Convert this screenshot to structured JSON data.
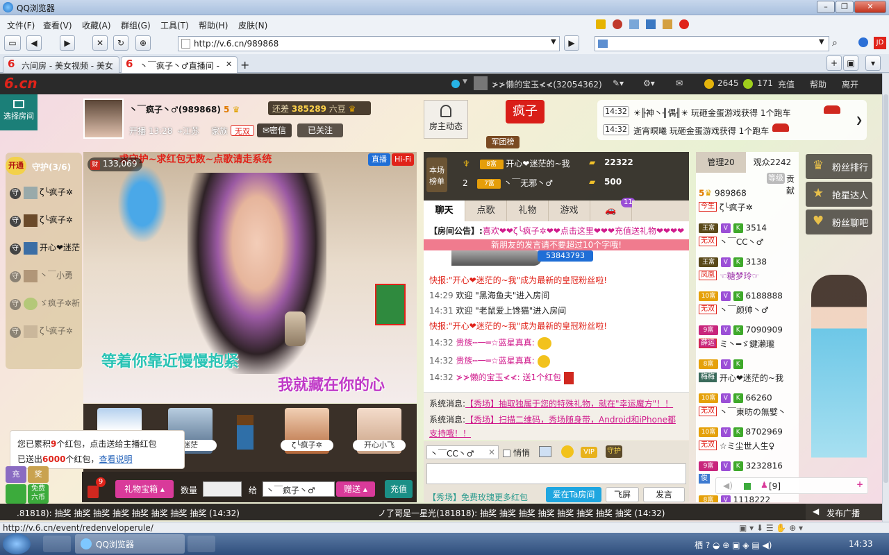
{
  "browser": {
    "title": "QQ浏览器",
    "menu": [
      "文件(F)",
      "查看(V)",
      "收藏(A)",
      "群组(G)",
      "工具(T)",
      "帮助(H)",
      "皮肤(N)"
    ],
    "address": "http://v.6.cn/989868",
    "tabs": [
      "六间房 - 美女视频 - 美女",
      "丶￣疯子丶♂直播间 -"
    ],
    "status_url": "http://v.6.cn/event/redenveloperule/",
    "clock": "14:33",
    "task_label": "QQ浏览器"
  },
  "site": {
    "logo": "6.cn",
    "user_name": "≯≯懒的宝玉≮≮(32054362)",
    "coins": "2645",
    "beans": "171",
    "recharge": "充值",
    "help": "帮助",
    "leave": "离开"
  },
  "anchor": {
    "select_room": "选择房间",
    "name": "丶￣疯子丶♂(989868)",
    "level_badge": "5",
    "remain_label": "还差",
    "remain_value": "385289",
    "remain_suffix": "六豆",
    "start_label": "开播 13:28",
    "location": "江苏",
    "family_label": "家族",
    "family_tag": "无双",
    "secret_btn": "密信",
    "follow_btn": "已关注",
    "host_news": "房主动态",
    "army": "军团榜",
    "nickname_badge": "疯子",
    "notices": [
      {
        "time": "14:32",
        "text": "☀╟神丶╢偶╢☀ 玩砸金蛋游戏获得 1个跑车"
      },
      {
        "time": "14:32",
        "text": "逝宵暝曦 玩砸金蛋游戏获得 1个跑车"
      }
    ]
  },
  "guard": {
    "open": "开通",
    "title": "守护(3/6)",
    "members": [
      "ζ╰疯子✲",
      "ζ╰疯子✲",
      "开心❤迷茫",
      "丶￣小勇",
      "ゞ疯子✲新",
      "ζ╰疯子✲"
    ]
  },
  "video": {
    "banner": "~求守护~求红包无数~点歌请走系统",
    "viewers": "133,069",
    "live_tag": "直播",
    "hifi_tag": "Hi-Fi",
    "lyric1": "等着你靠近慢慢抱紧",
    "lyric2": "我就藏在你的心"
  },
  "gift_row": {
    "items": [
      "",
      "迷茫",
      "",
      "ζ╰疯子✲",
      "开心小飞"
    ],
    "redpack_line1_prefix": "您已累积",
    "redpack_line1_count": "9",
    "redpack_line1_suffix": "个红包，点击送给主播红包",
    "redpack_line2_prefix": "已送出",
    "redpack_line2_count": "6000",
    "redpack_line2_suffix": "个红包，",
    "redpack_link": "查看说明"
  },
  "controls": {
    "badge": "9",
    "gift_box": "礼物宝箱",
    "qty_label": "数量",
    "to_label": "给",
    "to_name": "丶￣疯子丶♂",
    "send": "赠送",
    "recharge": "充值",
    "side1": "充",
    "side2": "奖",
    "free": "免费",
    "free2": "六币"
  },
  "rank": {
    "title1": "本场",
    "title2": "榜单",
    "rows": [
      {
        "rank": "1",
        "level": "8富",
        "name": "开心❤迷茫的~我",
        "value": "22322"
      },
      {
        "rank": "2",
        "level": "7富",
        "name": "丶￣无邪丶♂",
        "value": "500"
      }
    ]
  },
  "chat": {
    "tabs": [
      "聊天",
      "点歌",
      "礼物",
      "游戏"
    ],
    "car_badge": "11",
    "announcement_label": "【房间公告】:",
    "announcement_text": "喜欢❤❤ζ╰疯子✲❤❤点击这里❤❤❤充值送礼物❤❤❤❤❤❤",
    "newbie_tip": "新朋友的发言请不要超过10个字哦!",
    "plane_id": "53843793",
    "messages": [
      {
        "time": "",
        "text": "快报:\"开心❤迷茫的~我\"成为最新的皇冠粉丝啦!",
        "kind": "red"
      },
      {
        "time": "14:29",
        "text": "欢迎 \"黑海鱼夫\"进入房间",
        "kind": "normal"
      },
      {
        "time": "14:31",
        "text": "欢迎 \"老鼠爱上馋猫\"进入房间",
        "kind": "normal"
      },
      {
        "time": "",
        "text": "快报:\"开心❤迷茫的~我\"成为最新的皇冠粉丝啦!",
        "kind": "red"
      },
      {
        "time": "14:32",
        "text": "贵族┉一═☆蓝星真真:",
        "kind": "pink"
      },
      {
        "time": "14:32",
        "text": "贵族┉一═☆蓝星真真:",
        "kind": "pink"
      },
      {
        "time": "14:32",
        "text": "≯≯懒的宝玉≮≮: 送1个红包",
        "kind": "pink"
      }
    ],
    "system": [
      {
        "label": "系统消息:",
        "text": "【秀场】抽取独属于您的特殊礼物，就在\"幸运魔方\"！！"
      },
      {
        "label": "系统消息:",
        "text": "【秀场】扫描二维码，秀场随身带，Android和iPhone都支持哦！！"
      }
    ],
    "input_target": "丶￣CC丶♂",
    "whisper": "悄悄",
    "vip_tag": "VIP",
    "guard_tag": "守护",
    "promo": "【秀场】免费玫瑰更多红包",
    "love_btn": "爱在Ta房间",
    "fly_btn": "飞屏",
    "send_btn": "发言"
  },
  "userlist": {
    "tab_admin": "管理20",
    "tab_viewers": "观众2242",
    "sort_level": "等级",
    "sort_contrib": "贡献",
    "users": [
      {
        "id": "989868",
        "tag": "今生",
        "name": "ζ╰疯子✲",
        "lv": "5"
      },
      {
        "id": "3514",
        "tag": "无双",
        "name": "丶￣CC丶♂",
        "lv": "王富"
      },
      {
        "id": "3138",
        "tag": "凤凰",
        "name": "☜糖梦玲☞",
        "lv": "王富"
      },
      {
        "id": "6188888",
        "tag": "无双",
        "name": "丶￣颜帅丶♂",
        "lv": "10富"
      },
      {
        "id": "7090909",
        "tag": "薛运",
        "name": "ミ丶━ゞ鍵瀨瓏",
        "lv": "9富"
      },
      {
        "id": "",
        "tag": "梅梅",
        "name": "开心❤迷茫的~我",
        "lv": "8富"
      },
      {
        "id": "66260",
        "tag": "无双",
        "name": "丶￣東昉の無嬖丶",
        "lv": "10富"
      },
      {
        "id": "8702969",
        "tag": "无双",
        "name": "☆ミ尘世人生♀",
        "lv": "10富"
      },
      {
        "id": "3232816",
        "tag": "俊",
        "name": "",
        "lv": "9富"
      },
      {
        "id": "1118222",
        "tag": "",
        "name": "",
        "lv": "8富"
      }
    ],
    "mini_count": "[9]"
  },
  "side": {
    "fans_rank": "粉丝排行",
    "star_grab": "抢星达人",
    "fans_chat": "粉丝聊吧",
    "broadcast": "发布广播"
  },
  "marquee": {
    "left": ".81818): 抽奖 抽奖 抽奖 抽奖 抽奖 抽奖 抽奖 抽奖 (14:32)",
    "right": "ノ了哥是一星光(181818): 抽奖 抽奖 抽奖 抽奖 抽奖 抽奖 抽奖 抽奖 (14:32)"
  },
  "colors": {
    "accent": "#e0231a",
    "pink": "#d01b8c",
    "dark": "#2a2a2a",
    "teal": "#1b7f78"
  }
}
